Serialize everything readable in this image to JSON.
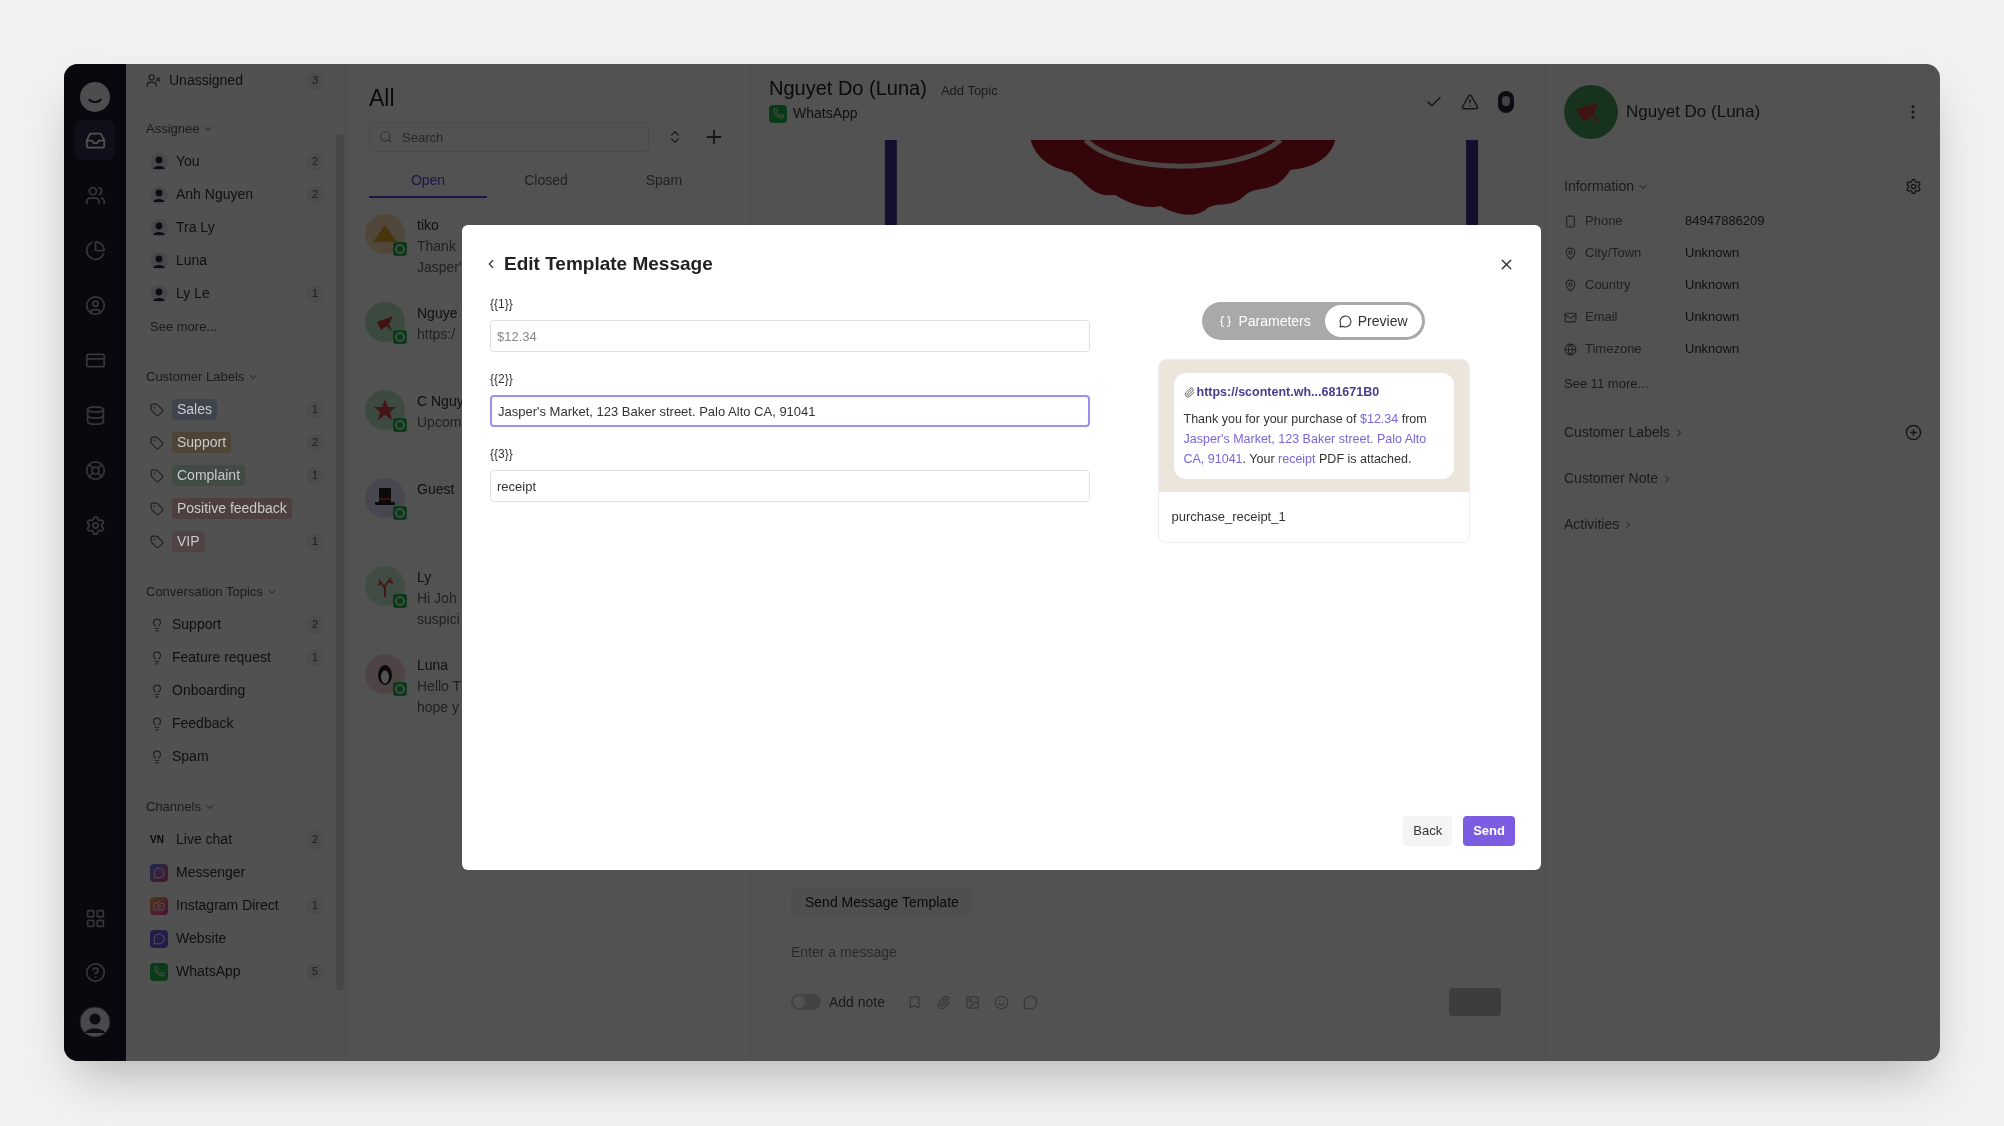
{
  "rail": {
    "top": [
      {
        "kind": "inbox",
        "selected": true
      },
      {
        "kind": "contacts",
        "selected": false
      },
      {
        "kind": "reports",
        "selected": false
      },
      {
        "kind": "agent",
        "selected": false
      },
      {
        "kind": "broadcast",
        "selected": false
      },
      {
        "kind": "database",
        "selected": false
      },
      {
        "kind": "support",
        "selected": false
      },
      {
        "kind": "settings",
        "selected": false
      }
    ],
    "bottom": [
      {
        "kind": "apps"
      },
      {
        "kind": "help"
      },
      {
        "kind": "profile"
      }
    ]
  },
  "sidebar": {
    "unassigned": {
      "label": "Unassigned",
      "count": "3"
    },
    "sections": [
      {
        "title": "Assignee",
        "kind": "people",
        "expanded": true,
        "more": "See more...",
        "items": [
          {
            "label": "You",
            "count": "2"
          },
          {
            "label": "Anh Nguyen",
            "count": "2"
          },
          {
            "label": "Tra Ly"
          },
          {
            "label": "Luna"
          },
          {
            "label": "Ly Le",
            "count": "1"
          }
        ]
      },
      {
        "title": "Customer Labels",
        "kind": "labels",
        "expanded": true,
        "items": [
          {
            "label": "Sales",
            "count": "1",
            "color": "#3f454e"
          },
          {
            "label": "Support",
            "count": "2",
            "color": "#4f4536"
          },
          {
            "label": "Complaint",
            "count": "1",
            "color": "#404b44"
          },
          {
            "label": "Positive feedback",
            "color": "#4e403f"
          },
          {
            "label": "VIP",
            "count": "1",
            "color": "#4f4343"
          }
        ]
      },
      {
        "title": "Conversation Topics",
        "kind": "topics",
        "expanded": true,
        "items": [
          {
            "label": "Support",
            "count": "2"
          },
          {
            "label": "Feature request",
            "count": "1"
          },
          {
            "label": "Onboarding"
          },
          {
            "label": "Feedback"
          },
          {
            "label": "Spam"
          }
        ]
      },
      {
        "title": "Channels",
        "kind": "channels",
        "expanded": true,
        "items": [
          {
            "label": "Live chat",
            "count": "2",
            "kind": "livechat",
            "icon_text": "VN"
          },
          {
            "label": "Messenger",
            "kind": "messenger"
          },
          {
            "label": "Instagram Direct",
            "count": "1",
            "kind": "instagram"
          },
          {
            "label": "Website",
            "kind": "website"
          },
          {
            "label": "WhatsApp",
            "count": "5",
            "kind": "whatsapp"
          }
        ]
      }
    ]
  },
  "conversations": {
    "title": "All",
    "search_placeholder": "Search",
    "tabs": [
      {
        "label": "Open",
        "selected": true
      },
      {
        "label": "Closed",
        "selected": false
      },
      {
        "label": "Spam",
        "selected": false
      }
    ],
    "items": [
      {
        "name": "tiko",
        "lines": [
          "Thank",
          "Jasper'"
        ],
        "kind": "tent"
      },
      {
        "name": "Nguye",
        "lines": [
          "https:/"
        ],
        "kind": "figure"
      },
      {
        "name": "C Nguy",
        "lines": [
          "Upcom"
        ],
        "kind": "star"
      },
      {
        "name": "Guest",
        "kind": "hat"
      },
      {
        "name": "Ly",
        "lines": [
          "Hi Joh",
          "suspici"
        ],
        "kind": "coral"
      },
      {
        "name": "Luna",
        "lines": [
          "Hello T",
          "hope y"
        ],
        "kind": "penguin"
      }
    ]
  },
  "chat": {
    "contact_name": "Nguyet Do (Luna)",
    "add_topic": "Add Topic",
    "channel": "WhatsApp",
    "template_button": "Send Message Template",
    "composer_placeholder": "Enter a message",
    "add_note": {
      "label": "Add note",
      "on": false
    }
  },
  "contact_panel": {
    "name": "Nguyet Do (Luna)",
    "sections": [
      {
        "title": "Information",
        "expanded": true,
        "more": "See 11 more...",
        "fields": [
          {
            "kind": "phone",
            "label": "Phone",
            "value": "84947886209"
          },
          {
            "kind": "pin",
            "label": "City/Town",
            "value": "Unknown"
          },
          {
            "kind": "pin",
            "label": "Country",
            "value": "Unknown"
          },
          {
            "kind": "mail",
            "label": "Email",
            "value": "Unknown"
          },
          {
            "kind": "globe",
            "label": "Timezone",
            "value": "Unknown"
          }
        ]
      },
      {
        "title": "Customer Labels",
        "expanded": false,
        "kind": "labels"
      },
      {
        "title": "Customer Note",
        "expanded": false,
        "kind": "note"
      },
      {
        "title": "Activities",
        "expanded": false,
        "kind": "activities"
      }
    ]
  },
  "modal": {
    "title": "Edit Template Message",
    "params": [
      {
        "label": "{{1}}",
        "placeholder": "$12.34",
        "focused": false
      },
      {
        "label": "{{2}}",
        "value": "Jasper's Market, 123 Baker street. Palo Alto CA, 91041",
        "focused": true
      },
      {
        "label": "{{3}}",
        "value": "receipt",
        "focused": false
      }
    ],
    "view_tabs": [
      {
        "label": "Parameters",
        "kind": "parameters",
        "selected": false
      },
      {
        "label": "Preview",
        "kind": "preview",
        "selected": true
      }
    ],
    "preview": {
      "attachment": "https://scontent.wh...681671B0",
      "body": [
        {
          "text": "Thank you for your purchase of ",
          "kind": "plain"
        },
        {
          "text": "$12.34",
          "kind": "param"
        },
        {
          "text": " from ",
          "kind": "plain"
        },
        {
          "text": "Jasper's Market, 123 Baker street. Palo Alto CA, 91041",
          "kind": "param"
        },
        {
          "text": ". Your ",
          "kind": "plain"
        },
        {
          "text": "receipt",
          "kind": "param"
        },
        {
          "text": " PDF is attached.",
          "kind": "plain"
        }
      ],
      "template_name": "purchase_receipt_1"
    },
    "buttons": [
      {
        "label": "Back",
        "kind": "secondary"
      },
      {
        "label": "Send",
        "kind": "primary"
      }
    ]
  }
}
